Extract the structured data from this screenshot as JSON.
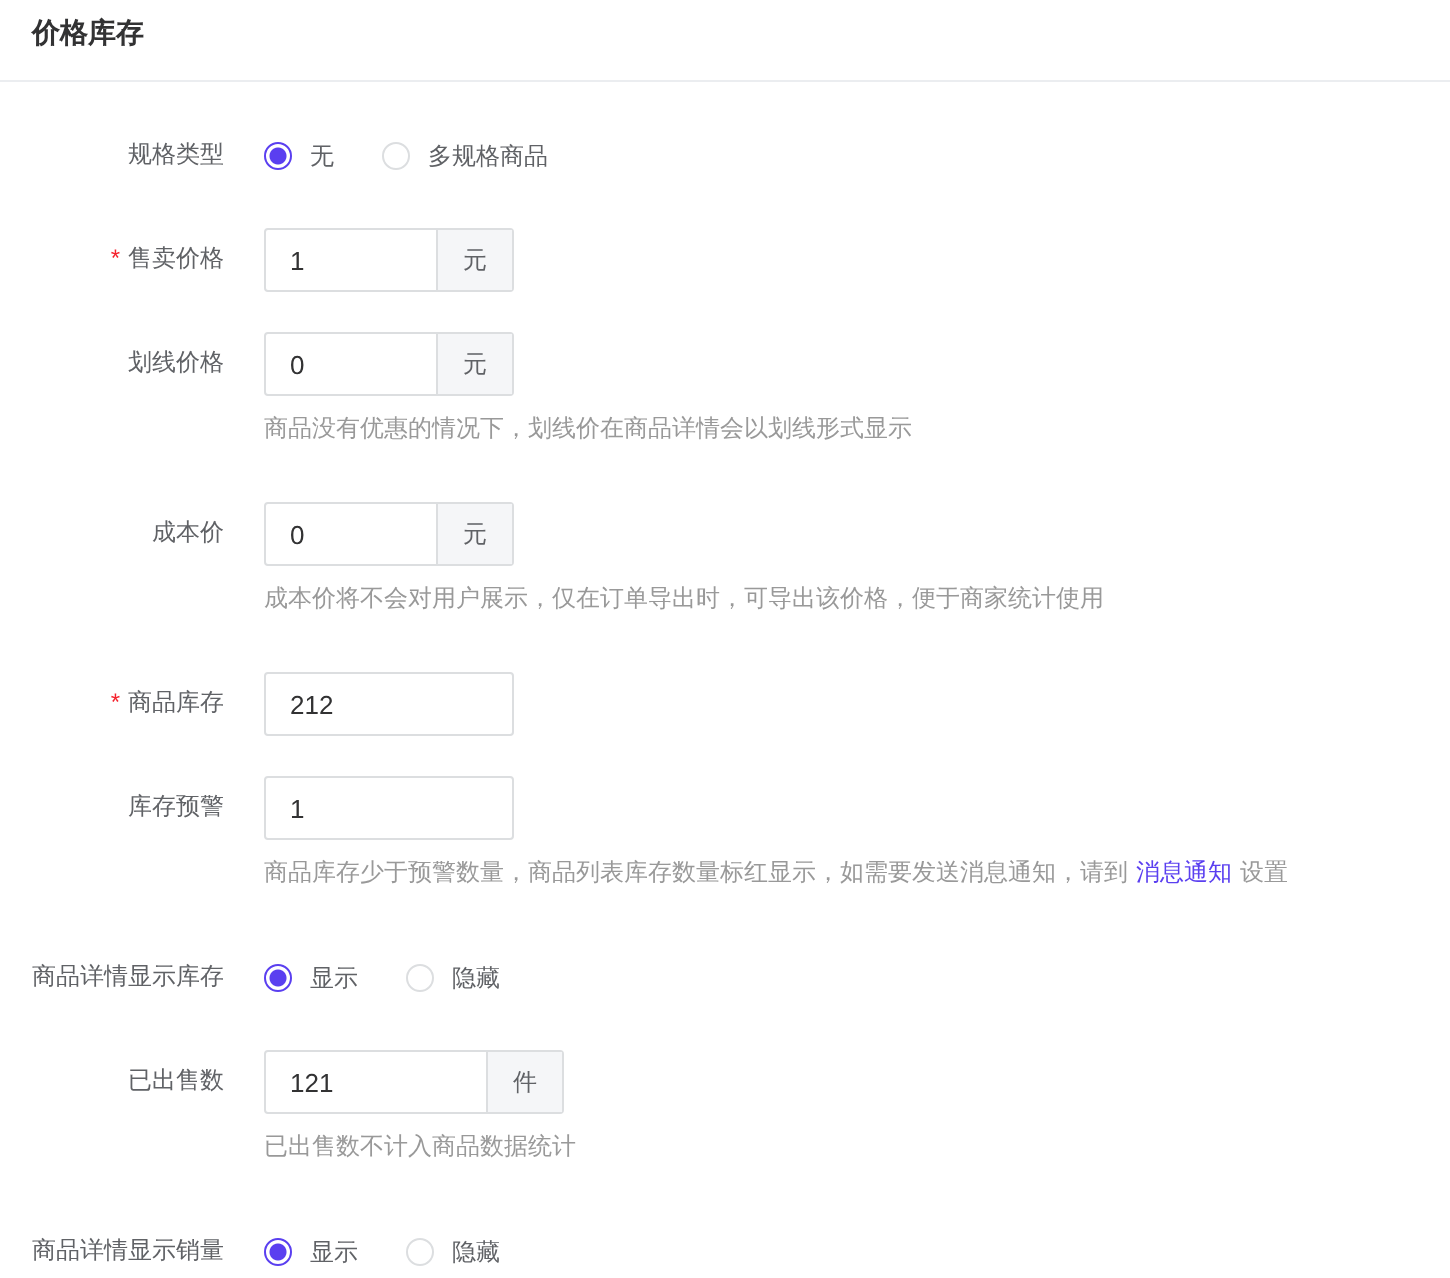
{
  "section": {
    "title": "价格库存"
  },
  "fields": [
    {
      "kind": "radio",
      "label": "规格类型",
      "options": [
        {
          "label": "无",
          "selected": true
        },
        {
          "label": "多规格商品",
          "selected": false
        }
      ]
    },
    {
      "kind": "input",
      "label": "售卖价格",
      "required_mark": "*",
      "value": "1",
      "suffix": "元"
    },
    {
      "kind": "input",
      "label": "划线价格",
      "value": "0",
      "suffix": "元",
      "help": "商品没有优惠的情况下，划线价在商品详情会以划线形式显示"
    },
    {
      "kind": "input",
      "label": "成本价",
      "value": "0",
      "suffix": "元",
      "help": "成本价将不会对用户展示，仅在订单导出时，可导出该价格，便于商家统计使用"
    },
    {
      "kind": "input",
      "label": "商品库存",
      "required_mark": "*",
      "value": "212"
    },
    {
      "kind": "input",
      "label": "库存预警",
      "value": "1",
      "help": "商品库存少于预警数量，商品列表库存数量标红显示，如需要发送消息通知，请到",
      "help_link": "消息通知",
      "help_after": "设置"
    },
    {
      "kind": "radio",
      "label": "商品详情显示库存",
      "options": [
        {
          "label": "显示",
          "selected": true
        },
        {
          "label": "隐藏",
          "selected": false
        }
      ]
    },
    {
      "kind": "input",
      "label": "已出售数",
      "value": "121",
      "suffix": "件",
      "wide": true,
      "help": "已出售数不计入商品数据统计"
    },
    {
      "kind": "radio",
      "label": "商品详情显示销量",
      "options": [
        {
          "label": "显示",
          "selected": true
        },
        {
          "label": "隐藏",
          "selected": false
        }
      ]
    }
  ]
}
